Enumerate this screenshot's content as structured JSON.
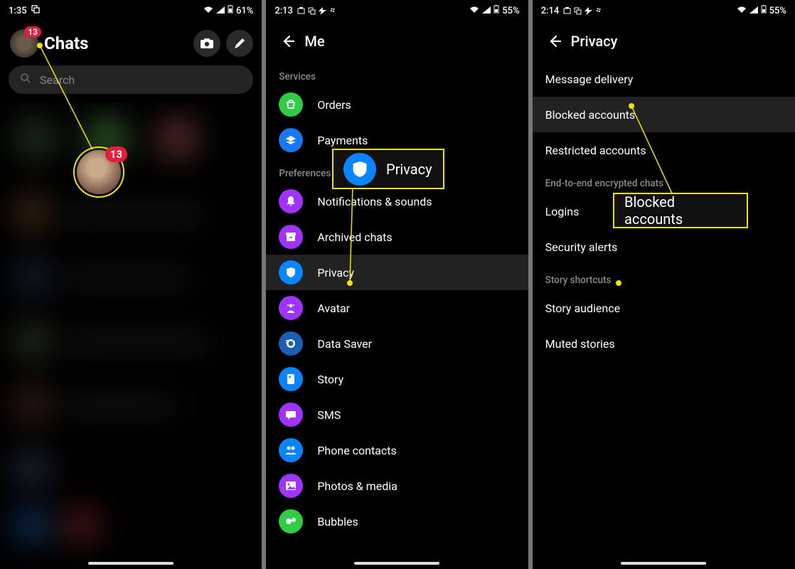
{
  "screen1": {
    "status": {
      "time": "1:35",
      "battery": "61%"
    },
    "badge": "13",
    "title": "Chats",
    "search_placeholder": "Search"
  },
  "screen2": {
    "status": {
      "time": "2:13",
      "battery": "55%"
    },
    "title": "Me",
    "sections": {
      "services": "Services",
      "preferences": "Preferences"
    },
    "items": {
      "orders": "Orders",
      "payments": "Payments",
      "notif": "Notifications & sounds",
      "archived": "Archived chats",
      "privacy": "Privacy",
      "avatar": "Avatar",
      "datasaver": "Data Saver",
      "story": "Story",
      "sms": "SMS",
      "contacts": "Phone contacts",
      "photos": "Photos & media",
      "bubbles": "Bubbles"
    }
  },
  "screen3": {
    "status": {
      "time": "2:14",
      "battery": "55%"
    },
    "title": "Privacy",
    "items": {
      "delivery": "Message delivery",
      "blocked": "Blocked accounts",
      "restricted": "Restricted accounts",
      "e2e_header": "End-to-end encrypted chats",
      "logins": "Logins",
      "alerts": "Security alerts",
      "story_header": "Story shortcuts",
      "audience": "Story audience",
      "muted": "Muted stories"
    }
  },
  "callouts": {
    "privacy": "Privacy",
    "blocked": "Blocked accounts",
    "badge_big": "13"
  }
}
